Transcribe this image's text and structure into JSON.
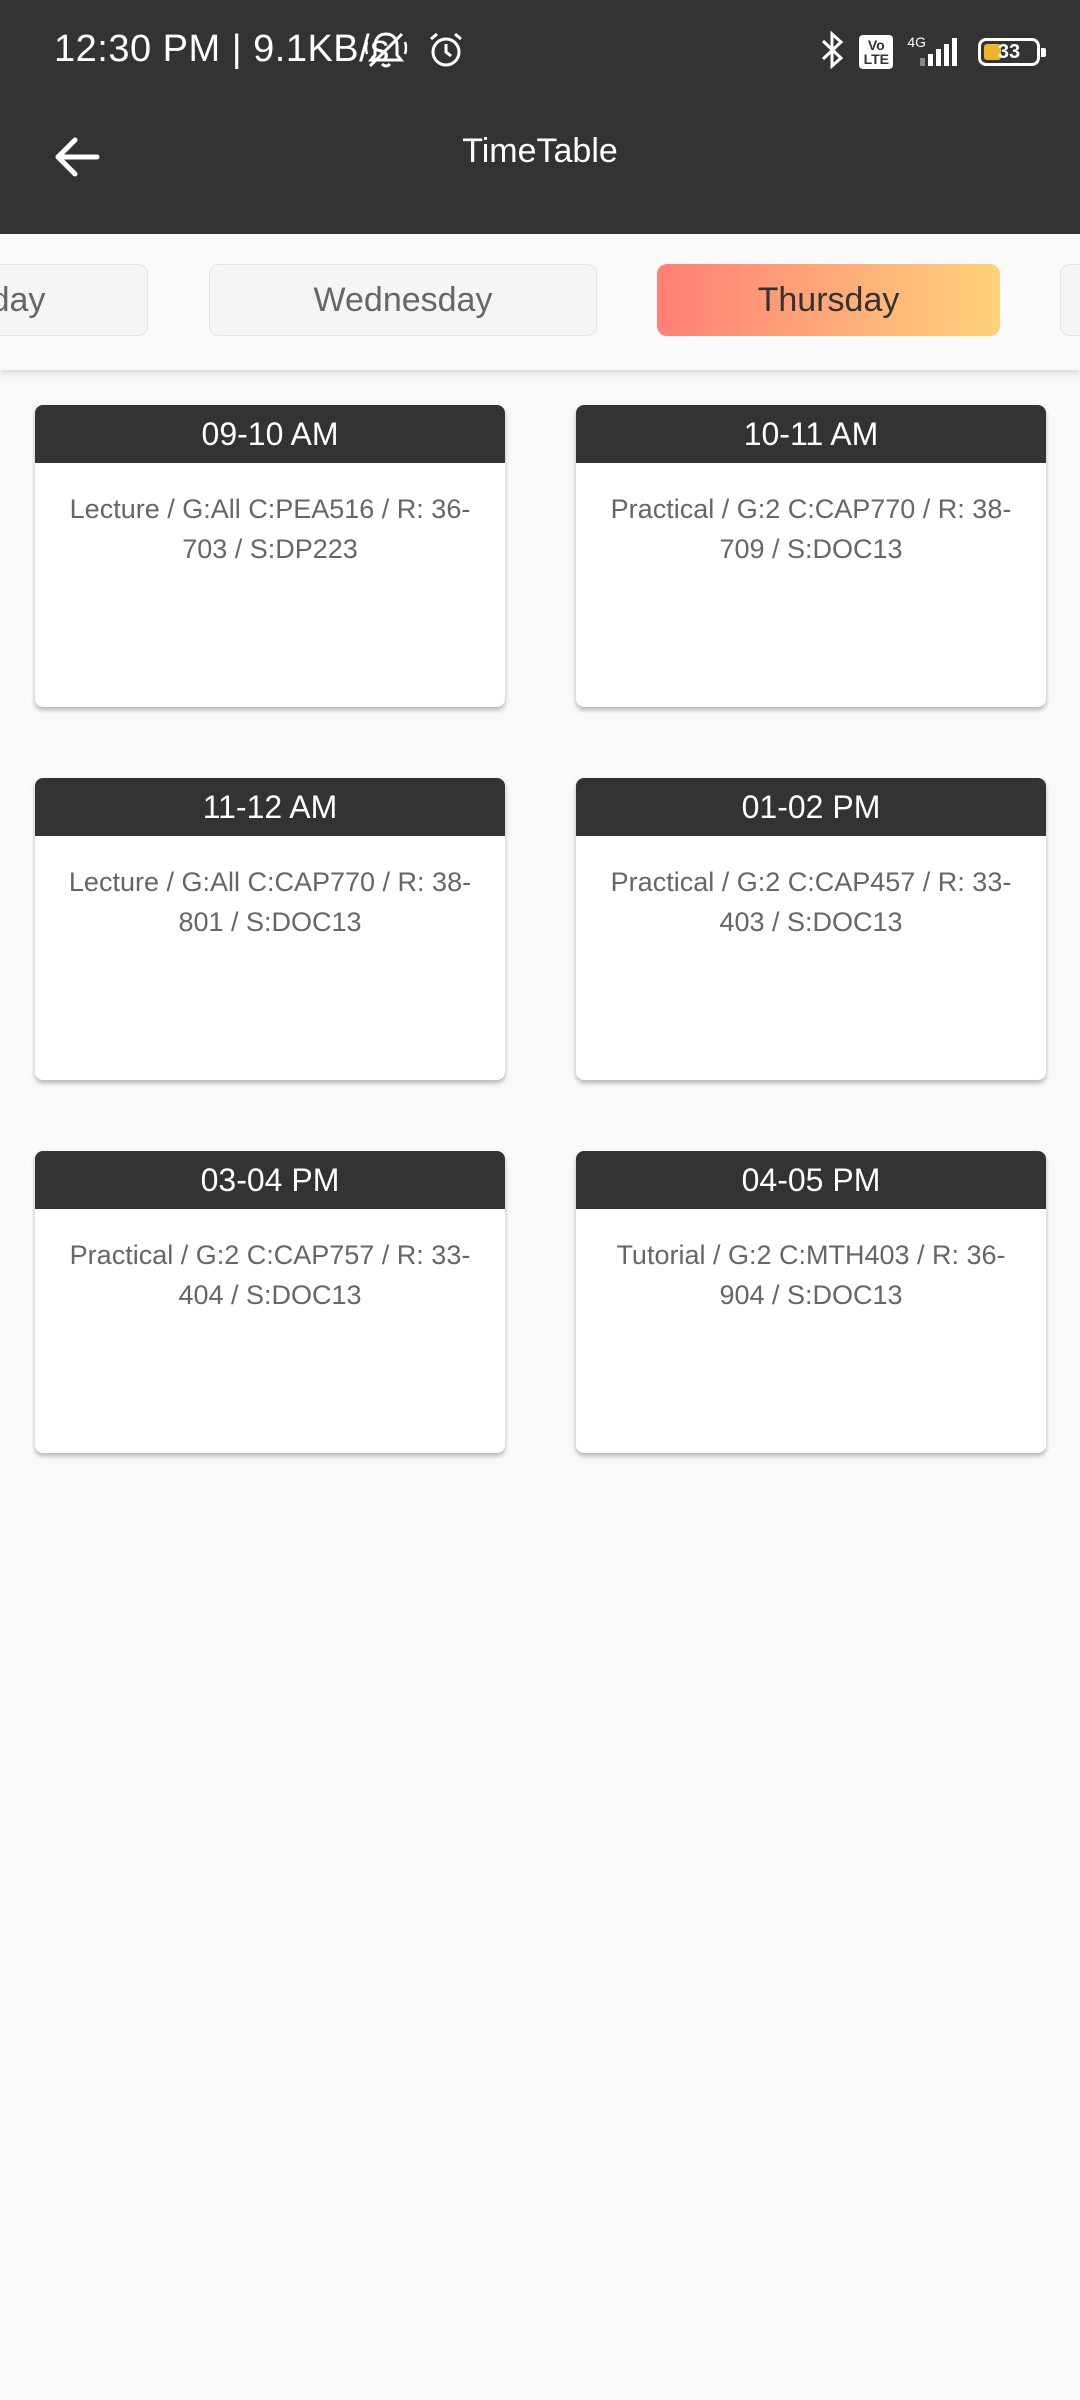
{
  "status_bar": {
    "time": "12:30 PM | 9.1KB/s",
    "volte": "Vo LTE",
    "network": "4G",
    "battery": "33"
  },
  "app_bar": {
    "title": "TimeTable"
  },
  "days": [
    {
      "label": "day",
      "active": false
    },
    {
      "label": "Wednesday",
      "active": false
    },
    {
      "label": "Thursday",
      "active": true
    },
    {
      "label": "",
      "active": false
    }
  ],
  "slots": [
    {
      "time": "09-10 AM",
      "details": "Lecture / G:All C:PEA516 / R: 36-703 / S:DP223"
    },
    {
      "time": "10-11 AM",
      "details": "Practical / G:2 C:CAP770 / R: 38-709 / S:DOC13"
    },
    {
      "time": "11-12 AM",
      "details": "Lecture / G:All C:CAP770 / R: 38-801 / S:DOC13"
    },
    {
      "time": "01-02 PM",
      "details": "Practical / G:2 C:CAP457 / R: 33-403 / S:DOC13"
    },
    {
      "time": "03-04 PM",
      "details": "Practical / G:2 C:CAP757 / R: 33-404 / S:DOC13"
    },
    {
      "time": "04-05 PM",
      "details": "Tutorial / G:2 C:MTH403 / R: 36-904 / S:DOC13"
    }
  ],
  "colors": {
    "header_bg": "#333333",
    "page_bg": "#f9f9f9",
    "active_gradient_start": "#ff7f75",
    "active_gradient_end": "#ffd27a",
    "battery_fill": "#f0b429"
  },
  "icons": {
    "back": "arrow-left-icon",
    "mute": "bell-off-icon",
    "alarm": "alarm-clock-icon",
    "bluetooth": "bluetooth-icon",
    "signal": "signal-bars-icon",
    "battery": "battery-icon"
  }
}
